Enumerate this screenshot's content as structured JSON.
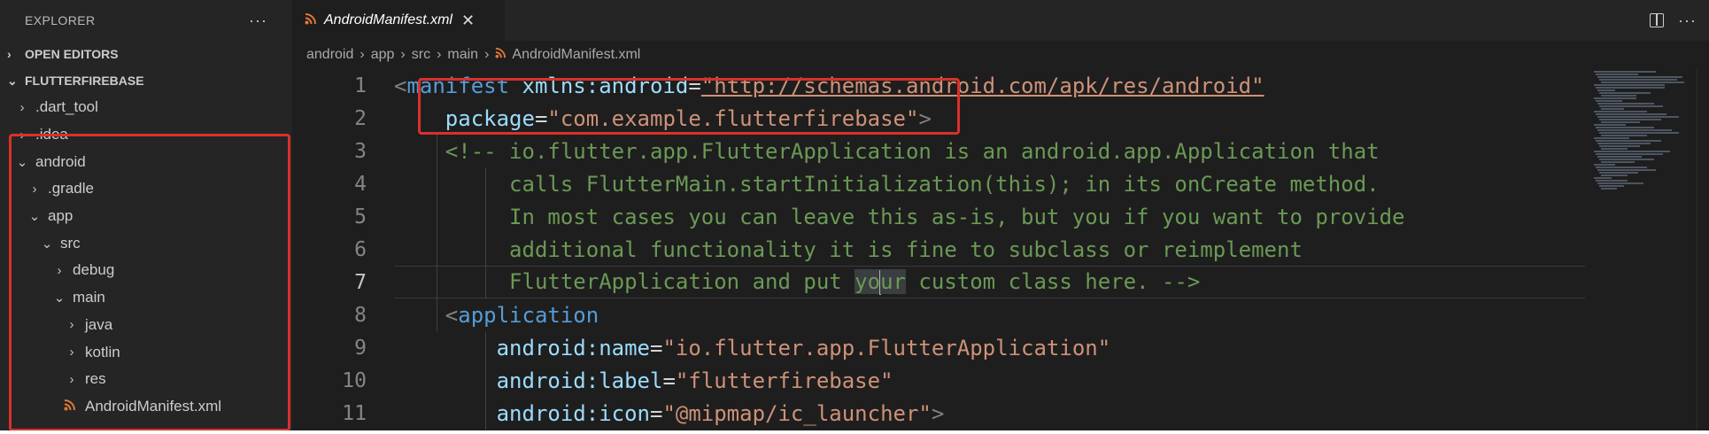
{
  "sidebar": {
    "title": "EXPLORER",
    "more": "···",
    "sections": [
      {
        "label": "OPEN EDITORS",
        "chevron": "›"
      },
      {
        "label": "FLUTTERFIREBASE",
        "chevron": "⌄"
      }
    ],
    "tree": [
      {
        "label": ".dart_tool",
        "chevron": "›"
      },
      {
        "label": ".idea",
        "chevron": "›"
      },
      {
        "label": "android",
        "chevron": "⌄"
      },
      {
        "label": ".gradle",
        "chevron": "›"
      },
      {
        "label": "app",
        "chevron": "⌄"
      },
      {
        "label": "src",
        "chevron": "⌄"
      },
      {
        "label": "debug",
        "chevron": "›"
      },
      {
        "label": "main",
        "chevron": "⌄"
      },
      {
        "label": "java",
        "chevron": "›"
      },
      {
        "label": "kotlin",
        "chevron": "›"
      },
      {
        "label": "res",
        "chevron": "›"
      },
      {
        "label": "AndroidManifest.xml",
        "icon": "rss-icon"
      }
    ]
  },
  "tabs": [
    {
      "label": "AndroidManifest.xml",
      "close": "✕",
      "icon": "rss-icon"
    }
  ],
  "tab_actions": {
    "more": "···"
  },
  "breadcrumb": {
    "items": [
      "android",
      "app",
      "src",
      "main"
    ],
    "separator": "›",
    "file": "AndroidManifest.xml"
  },
  "editor": {
    "lines": [
      {
        "n": "1",
        "tokens": [
          {
            "t": "punct",
            "v": "<"
          },
          {
            "t": "tag",
            "v": "manifest"
          },
          {
            "t": "plain",
            "v": " "
          },
          {
            "t": "attr",
            "v": "xmlns:android"
          },
          {
            "t": "plain",
            "v": "="
          },
          {
            "t": "str u",
            "v": "\"http://schemas.android.com/apk/res/android\""
          }
        ]
      },
      {
        "n": "2",
        "tokens": [
          {
            "t": "plain",
            "v": "    "
          },
          {
            "t": "attr",
            "v": "package"
          },
          {
            "t": "plain",
            "v": "="
          },
          {
            "t": "str",
            "v": "\"com.example.flutterfirebase\""
          },
          {
            "t": "punct",
            "v": ">"
          }
        ]
      },
      {
        "n": "3",
        "tokens": [
          {
            "t": "plain",
            "v": "    "
          },
          {
            "t": "cmt",
            "v": "<!-- io.flutter.app.FlutterApplication is an android.app.Application that"
          }
        ]
      },
      {
        "n": "4",
        "tokens": [
          {
            "t": "cmt",
            "v": "         calls FlutterMain.startInitialization(this); in its onCreate method."
          }
        ]
      },
      {
        "n": "5",
        "tokens": [
          {
            "t": "cmt",
            "v": "         In most cases you can leave this as-is, but you if you want to provide"
          }
        ]
      },
      {
        "n": "6",
        "tokens": [
          {
            "t": "cmt",
            "v": "         additional functionality it is fine to subclass or reimplement"
          }
        ]
      },
      {
        "n": "7",
        "current": true,
        "tokens": [
          {
            "t": "cmt",
            "v": "         FlutterApplication and put "
          },
          {
            "t": "cmt hl",
            "v": "yo"
          },
          {
            "t": "caret",
            "v": ""
          },
          {
            "t": "cmt hl",
            "v": "ur"
          },
          {
            "t": "cmt",
            "v": " custom class here. -->"
          }
        ]
      },
      {
        "n": "8",
        "tokens": [
          {
            "t": "plain",
            "v": "    "
          },
          {
            "t": "punct",
            "v": "<"
          },
          {
            "t": "tag",
            "v": "application"
          }
        ]
      },
      {
        "n": "9",
        "tokens": [
          {
            "t": "plain",
            "v": "        "
          },
          {
            "t": "attr",
            "v": "android:name"
          },
          {
            "t": "plain",
            "v": "="
          },
          {
            "t": "str",
            "v": "\"io.flutter.app.FlutterApplication\""
          }
        ]
      },
      {
        "n": "10",
        "tokens": [
          {
            "t": "plain",
            "v": "        "
          },
          {
            "t": "attr",
            "v": "android:label"
          },
          {
            "t": "plain",
            "v": "="
          },
          {
            "t": "str",
            "v": "\"flutterfirebase\""
          }
        ]
      },
      {
        "n": "11",
        "tokens": [
          {
            "t": "plain",
            "v": "        "
          },
          {
            "t": "attr",
            "v": "android:icon"
          },
          {
            "t": "plain",
            "v": "="
          },
          {
            "t": "str",
            "v": "\"@mipmap/ic_launcher\""
          },
          {
            "t": "punct",
            "v": ">"
          }
        ]
      }
    ]
  },
  "colors": {
    "highlight_box": "#d9312b",
    "rss_icon": "#e37933",
    "tag": "#569cd6",
    "attr": "#9cdcfe",
    "string": "#ce9178",
    "comment": "#6a9955"
  }
}
